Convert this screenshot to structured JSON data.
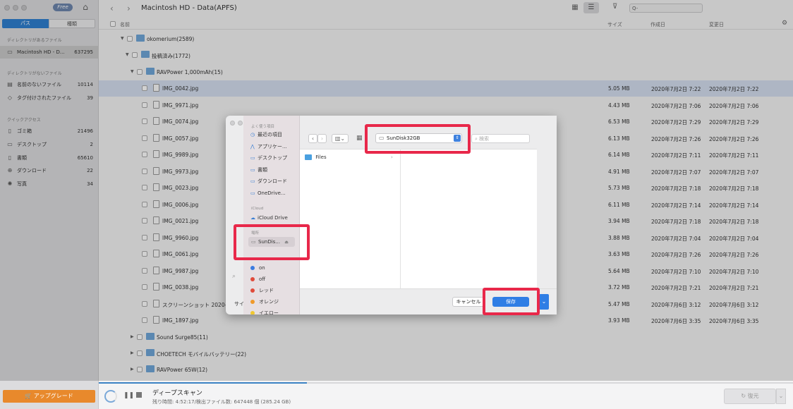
{
  "app": {
    "free_badge": "Free",
    "tabs": [
      "パス",
      "種類"
    ],
    "sections": {
      "with_dir": "ディレクトリがあるファイル",
      "without_dir": "ディレクトリがないファイル",
      "quick": "クイックアクセス"
    },
    "drive": {
      "label": "Macintosh HD - D...",
      "count": "637295"
    },
    "nodir_items": [
      {
        "label": "名前のないファイル",
        "count": "10114",
        "icon": "doc-icon"
      },
      {
        "label": "タグ付けされたファイル",
        "count": "39",
        "icon": "tag-icon"
      }
    ],
    "quick_items": [
      {
        "label": "ゴミ箱",
        "count": "21496",
        "icon": "trash-icon"
      },
      {
        "label": "デスクトップ",
        "count": "2",
        "icon": "desktop-icon"
      },
      {
        "label": "書類",
        "count": "65610",
        "icon": "document-icon"
      },
      {
        "label": "ダウンロード",
        "count": "22",
        "icon": "download-icon"
      },
      {
        "label": "写真",
        "count": "34",
        "icon": "photo-icon"
      }
    ],
    "upgrade": "アップグレード"
  },
  "toolbar": {
    "title": "Macintosh HD - Data(APFS)",
    "search_placeholder": "Q-"
  },
  "table": {
    "headers": {
      "name": "名前",
      "size": "サイズ",
      "created": "作成日",
      "modified": "変更日"
    },
    "folders": [
      {
        "name": "okomerium(2589)"
      },
      {
        "name": "投稿済み(1772)"
      },
      {
        "name": "RAVPower 1,000mAh(15)"
      }
    ],
    "files": [
      {
        "name": "IMG_0042.jpg",
        "size": "5.05 MB",
        "created": "2020年7月2日 7:22",
        "modified": "2020年7月2日 7:22"
      },
      {
        "name": "IMG_9971.jpg",
        "size": "4.43 MB",
        "created": "2020年7月2日 7:06",
        "modified": "2020年7月2日 7:06"
      },
      {
        "name": "IMG_0074.jpg",
        "size": "6.53 MB",
        "created": "2020年7月2日 7:29",
        "modified": "2020年7月2日 7:29"
      },
      {
        "name": "IMG_0057.jpg",
        "size": "6.13 MB",
        "created": "2020年7月2日 7:26",
        "modified": "2020年7月2日 7:26"
      },
      {
        "name": "IMG_9989.jpg",
        "size": "6.14 MB",
        "created": "2020年7月2日 7:11",
        "modified": "2020年7月2日 7:11"
      },
      {
        "name": "IMG_9973.jpg",
        "size": "4.91 MB",
        "created": "2020年7月2日 7:07",
        "modified": "2020年7月2日 7:07"
      },
      {
        "name": "IMG_0023.jpg",
        "size": "5.73 MB",
        "created": "2020年7月2日 7:18",
        "modified": "2020年7月2日 7:18"
      },
      {
        "name": "IMG_0006.jpg",
        "size": "6.11 MB",
        "created": "2020年7月2日 7:14",
        "modified": "2020年7月2日 7:14"
      },
      {
        "name": "IMG_0021.jpg",
        "size": "3.94 MB",
        "created": "2020年7月2日 7:18",
        "modified": "2020年7月2日 7:18"
      },
      {
        "name": "IMG_9960.jpg",
        "size": "3.88 MB",
        "created": "2020年7月2日 7:04",
        "modified": "2020年7月2日 7:04"
      },
      {
        "name": "IMG_0061.jpg",
        "size": "3.63 MB",
        "created": "2020年7月2日 7:26",
        "modified": "2020年7月2日 7:26"
      },
      {
        "name": "IMG_9987.jpg",
        "size": "5.64 MB",
        "created": "2020年7月2日 7:10",
        "modified": "2020年7月2日 7:10"
      },
      {
        "name": "IMG_0038.jpg",
        "size": "3.72 MB",
        "created": "2020年7月2日 7:21",
        "modified": "2020年7月2日 7:21"
      },
      {
        "name": "スクリーンショット 2020-",
        "size": "5.47 MB",
        "created": "2020年7月6日 3:12",
        "modified": "2020年7月6日 3:12"
      },
      {
        "name": "IMG_1897.jpg",
        "size": "3.93 MB",
        "created": "2020年7月6日 3:35",
        "modified": "2020年7月6日 3:35"
      }
    ],
    "more_folders": [
      {
        "name": "Sound Surge85(11)"
      },
      {
        "name": "CHOETECH モバイルバッテリー(22)"
      },
      {
        "name": "RAVPower 65W(12)"
      }
    ]
  },
  "scan": {
    "title": "ディープスキャン",
    "status": "残り時間: 4:52:17/検出ファイル数: 647448 個 (285.24 GB)",
    "restore": "復元"
  },
  "dialog": {
    "section_favorites": "よく使う項目",
    "favorites": [
      {
        "label": "最近の項目",
        "icon": "clock-icon",
        "glyph": "◷"
      },
      {
        "label": "アプリケー...",
        "icon": "apps-icon",
        "glyph": "⋀"
      },
      {
        "label": "デスクトップ",
        "icon": "desktop-icon",
        "glyph": "▭"
      },
      {
        "label": "書類",
        "icon": "folder-icon",
        "glyph": "▭"
      },
      {
        "label": "ダウンロード",
        "icon": "download-icon",
        "glyph": "▭"
      },
      {
        "label": "OneDrive...",
        "icon": "folder-icon",
        "glyph": "▭"
      }
    ],
    "section_icloud": "iCloud",
    "icloud_drive": "iCloud Drive",
    "section_places": "場所",
    "sundisk": "SunDis...",
    "tags": [
      {
        "label": "on",
        "color": "#3a7be0"
      },
      {
        "label": "off",
        "color": "#e04a3a"
      },
      {
        "label": "レッド",
        "color": "#e04a3a"
      },
      {
        "label": "オレンジ",
        "color": "#f09a2a"
      },
      {
        "label": "イエロー",
        "color": "#f0c830"
      }
    ],
    "location": "SunDisk32GB",
    "search_placeholder": "検索",
    "folder": "Files",
    "cancel": "キャンセル",
    "save": "保存",
    "left_label": "サイ"
  },
  "colors": {
    "accent": "#2f7ee5",
    "highlight": "#e8284a",
    "upgrade": "#e8892c"
  }
}
